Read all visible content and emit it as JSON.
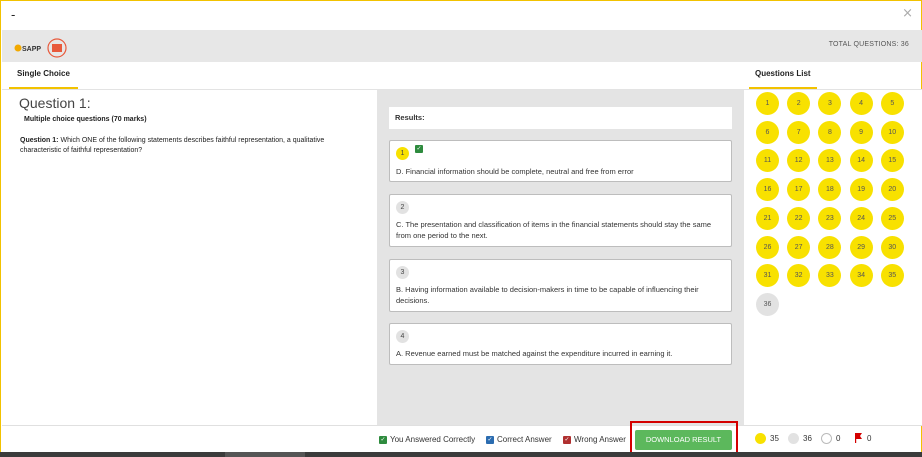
{
  "window": {
    "title": "-",
    "close_icon": "close-icon"
  },
  "header": {
    "total_questions": "TOTAL QUESTIONS: 36",
    "logo": "sapp-logo"
  },
  "tabs": {
    "single_choice": "Single Choice",
    "questions_list": "Questions List"
  },
  "question": {
    "title": "Question 1:",
    "section": "Multiple choice questions (70 marks)",
    "label": "Question 1:",
    "text": "Which ONE of the following statements describes faithful representation, a qualitative characteristic of faithful representation?"
  },
  "results": {
    "heading": "Results:",
    "options": [
      {
        "num": "1",
        "text": "D. Financial information should be complete, neutral and free from error",
        "selected": true,
        "correct": true
      },
      {
        "num": "2",
        "text": "C. The presentation and classification of items in the financial statements should stay the same from one period to the next.",
        "selected": false,
        "correct": false
      },
      {
        "num": "3",
        "text": "B. Having information available to decision-makers in time to be capable of influencing their decisions.",
        "selected": false,
        "correct": false
      },
      {
        "num": "4",
        "text": "A. Revenue earned must be matched against the expenditure incurred in earning it.",
        "selected": false,
        "correct": false
      }
    ]
  },
  "question_list": {
    "answered_color": "#f8e100",
    "unanswered_color": "#e2e2e2",
    "items": [
      "1",
      "2",
      "3",
      "4",
      "5",
      "6",
      "7",
      "8",
      "9",
      "10",
      "11",
      "12",
      "13",
      "14",
      "15",
      "16",
      "17",
      "18",
      "19",
      "20",
      "21",
      "22",
      "23",
      "24",
      "25",
      "26",
      "27",
      "28",
      "29",
      "30",
      "31",
      "32",
      "33",
      "34",
      "35",
      "36"
    ],
    "answered_count": 35
  },
  "legend": {
    "answered_correctly": "You Answered Correctly",
    "correct_answer": "Correct Answer",
    "wrong_answer": "Wrong Answer",
    "answered_correctly_color": "#2e8b3e",
    "correct_answer_color": "#2b6cb0",
    "wrong_answer_color": "#b03030"
  },
  "download_button": "DOWNLOAD RESULT",
  "stats": {
    "answered": "35",
    "total": "36",
    "unanswered": "0",
    "flagged": "0"
  }
}
